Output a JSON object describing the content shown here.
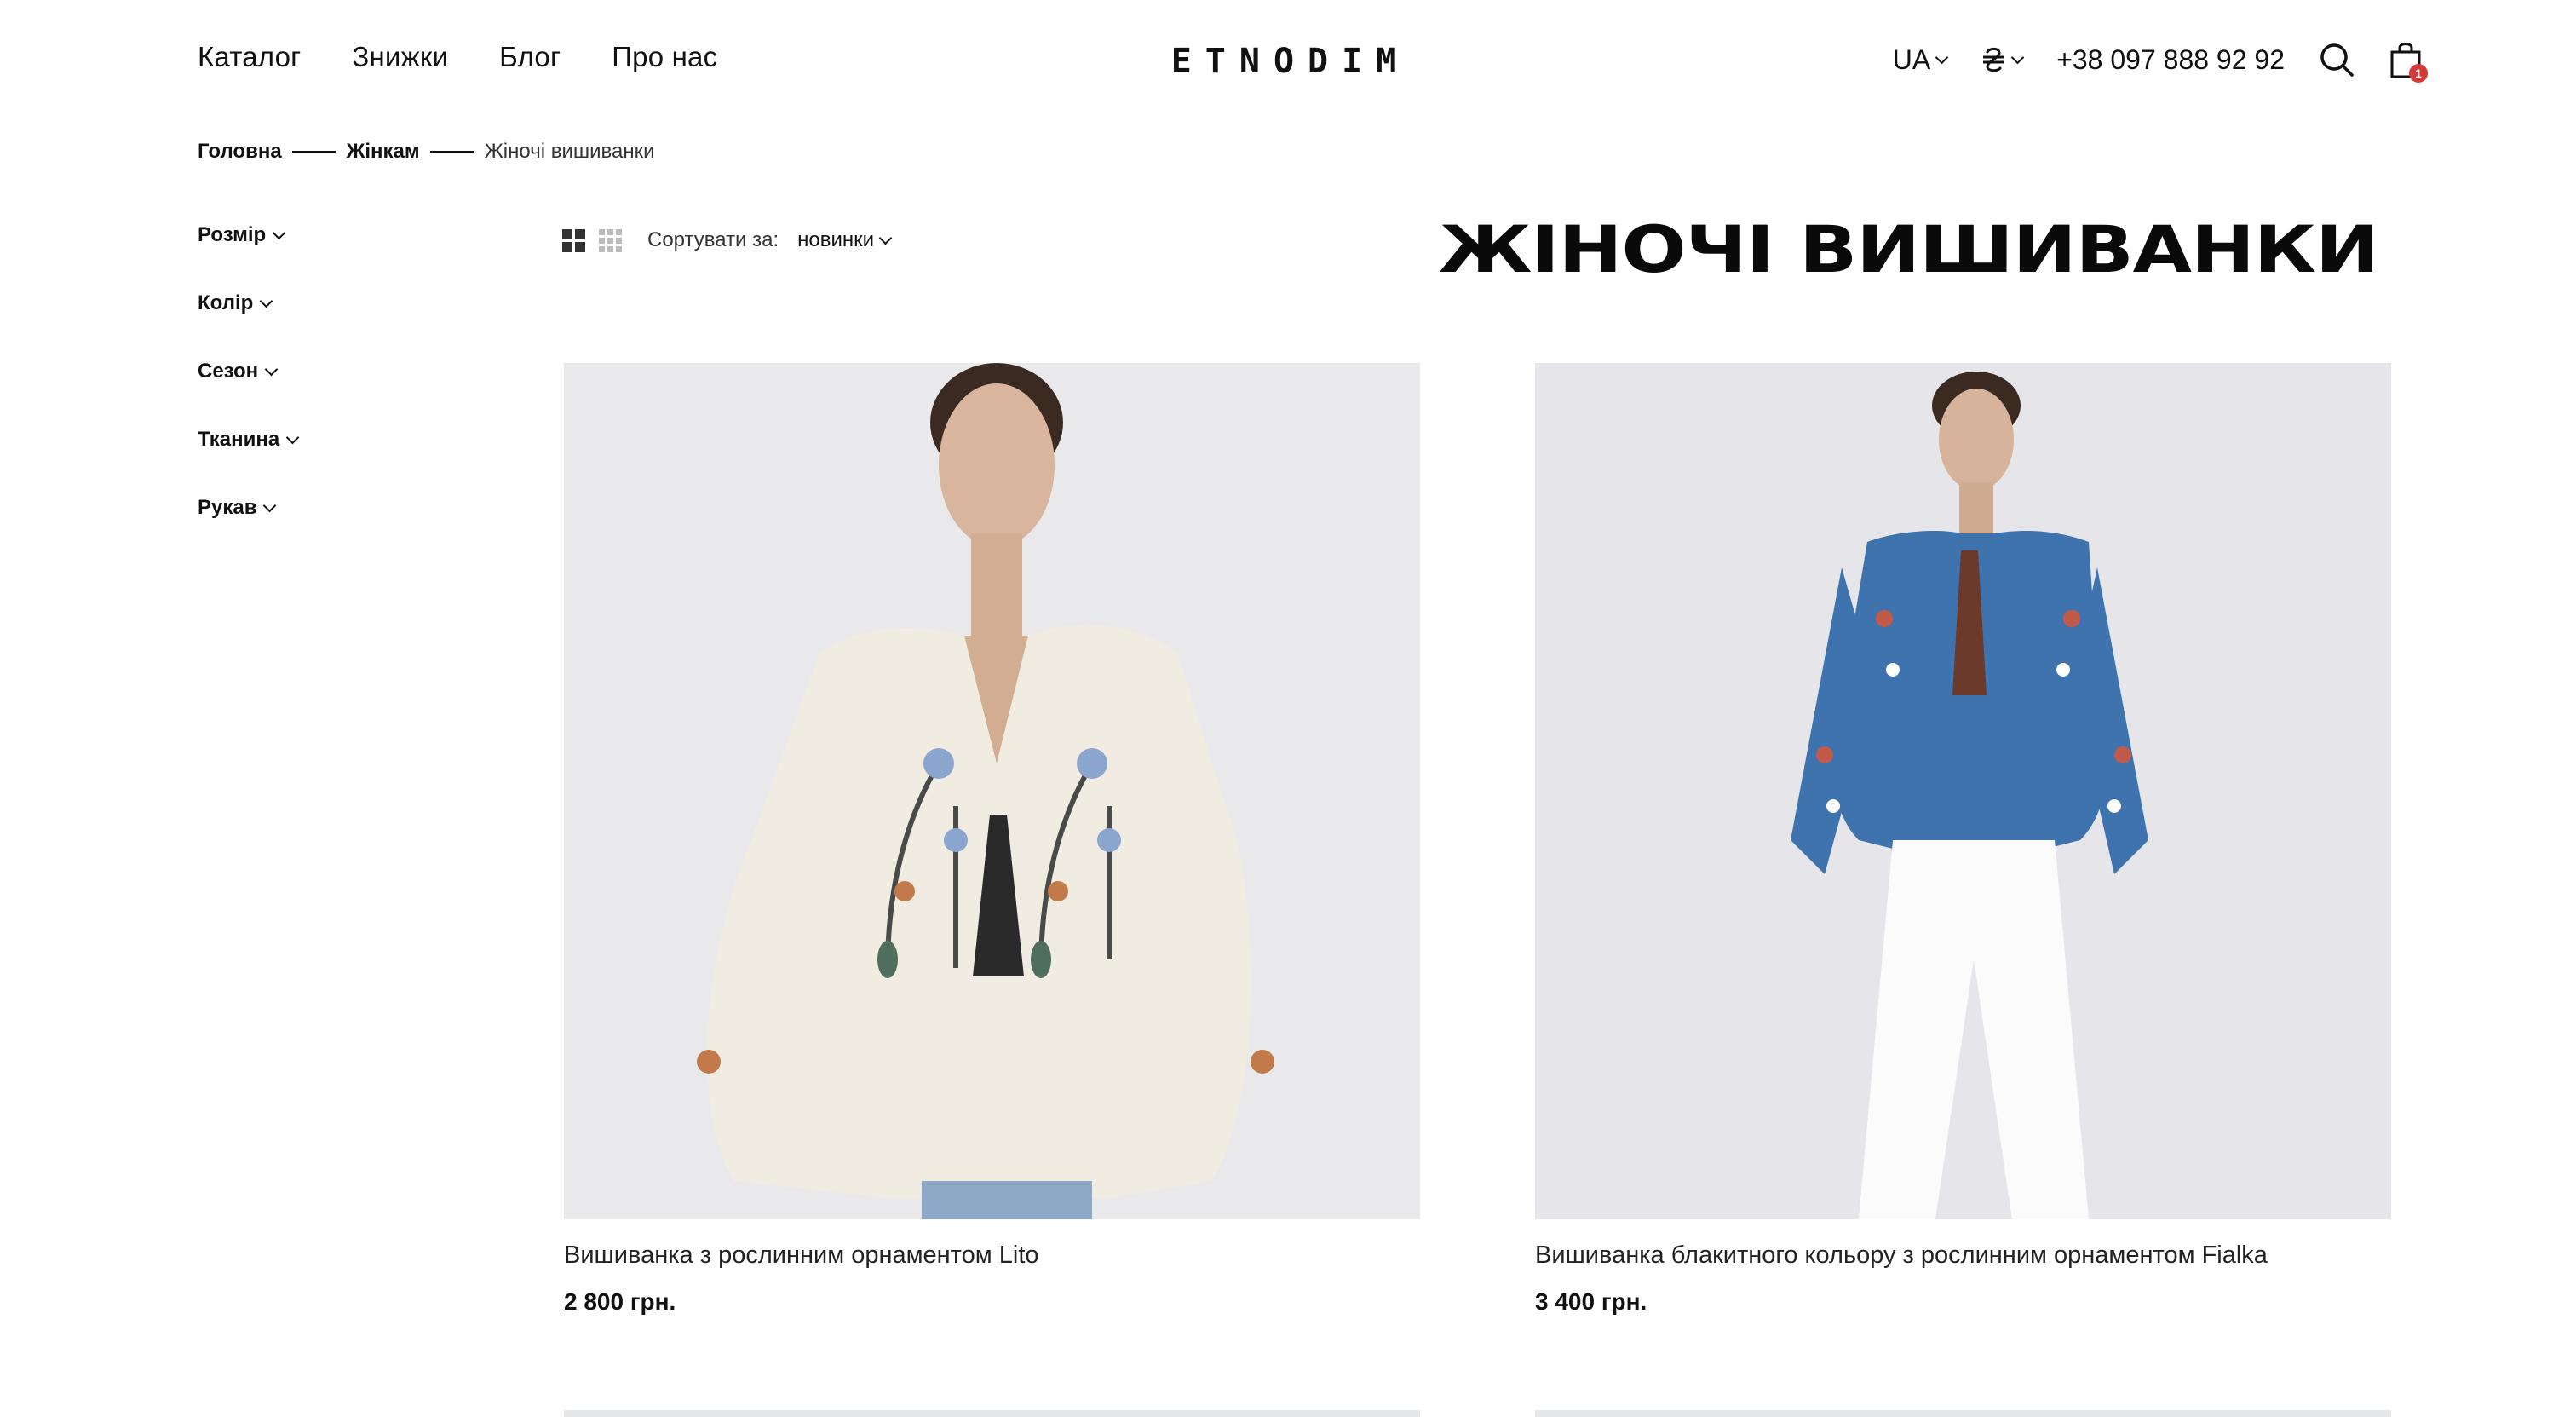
{
  "nav": {
    "items": [
      "Каталог",
      "Знижки",
      "Блог",
      "Про нас"
    ]
  },
  "logo": {
    "text": "ETNODIM"
  },
  "header_right": {
    "language": "UA",
    "currency_icon": "hryvnia-icon",
    "phone": "+38 097 888 92 92",
    "search_icon": "search-icon",
    "cart_icon": "shopping-bag-icon",
    "cart_count": "1"
  },
  "breadcrumb": {
    "items": [
      "Головна",
      "Жінкам"
    ],
    "current": "Жіночі вишиванки"
  },
  "filters": {
    "items": [
      "Розмір",
      "Колір",
      "Сезон",
      "Тканина",
      "Рукав"
    ]
  },
  "toolbar": {
    "sort_label": "Сортувати за:",
    "sort_value": "новинки"
  },
  "page_title": "ЖІНОЧІ ВИШИВАНКИ",
  "products": [
    {
      "name": "Вишиванка з рослинним орнаментом Lito",
      "price": "2 800 грн.",
      "shirt_color": "#f1ece1"
    },
    {
      "name": "Вишиванка блакитного кольору з рослинним орнаментом Fialka",
      "price": "3 400 грн.",
      "shirt_color": "#3f73ad"
    }
  ],
  "colors": {
    "badge": "#d33a3a",
    "photo_bg": "#e9e9ec"
  }
}
